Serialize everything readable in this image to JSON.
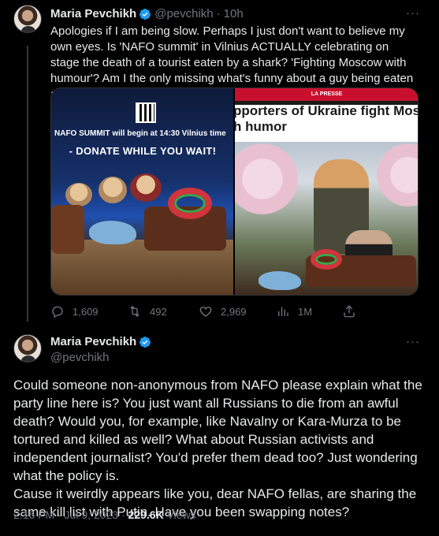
{
  "tweet1": {
    "author_name": "Maria Pevchikh",
    "handle": "@pevchikh",
    "separator": "·",
    "time": "10h",
    "more_label": "···",
    "text": "Apologies if I am being slow. Perhaps I just don't want to believe my own eyes. Is 'NAFO summit' in Vilnius ACTUALLY celebrating on stage the death of a tourist eaten by a shark? 'Fighting Moscow with humour'? Am I the only missing what's funny about a guy being eaten alive?",
    "media": {
      "left_image": {
        "summit_text": "NAFO SUMMIT will begin at 14:30 Vilnius time",
        "donate_text": "- DONATE WHILE YOU WAIT!"
      },
      "right_image": {
        "publisher": "LA PRESSE",
        "headline_line1": "pporters of Ukraine fight Mos",
        "headline_line2": "h humor"
      }
    },
    "actions": {
      "replies": "1,609",
      "retweets": "492",
      "likes": "2,969",
      "views": "1M"
    }
  },
  "tweet2": {
    "author_name": "Maria Pevchikh",
    "handle": "@pevchikh",
    "more_label": "···",
    "text": "Could someone non-anonymous from NAFO please explain what the party line here is? You just want all Russians to die from an awful death? Would you, for example, like Navalny or Kara-Murza to be tortured and killed as well? What about Russian activists and independent journalist? You'd prefer them dead too? Just wondering what the policy is.\nCause it weirdly appears like you, dear NAFO fellas, are sharing the same kill list with Putin. Have you been swapping notes?",
    "timestamp": "2:16 PM · Jul 9, 2023 · ",
    "views_count": "229.6K",
    "views_label": " Views"
  },
  "colors": {
    "background": "#000000",
    "text_primary": "#e7e9ea",
    "text_secondary": "#71767b",
    "verified": "#1d9bf0"
  }
}
